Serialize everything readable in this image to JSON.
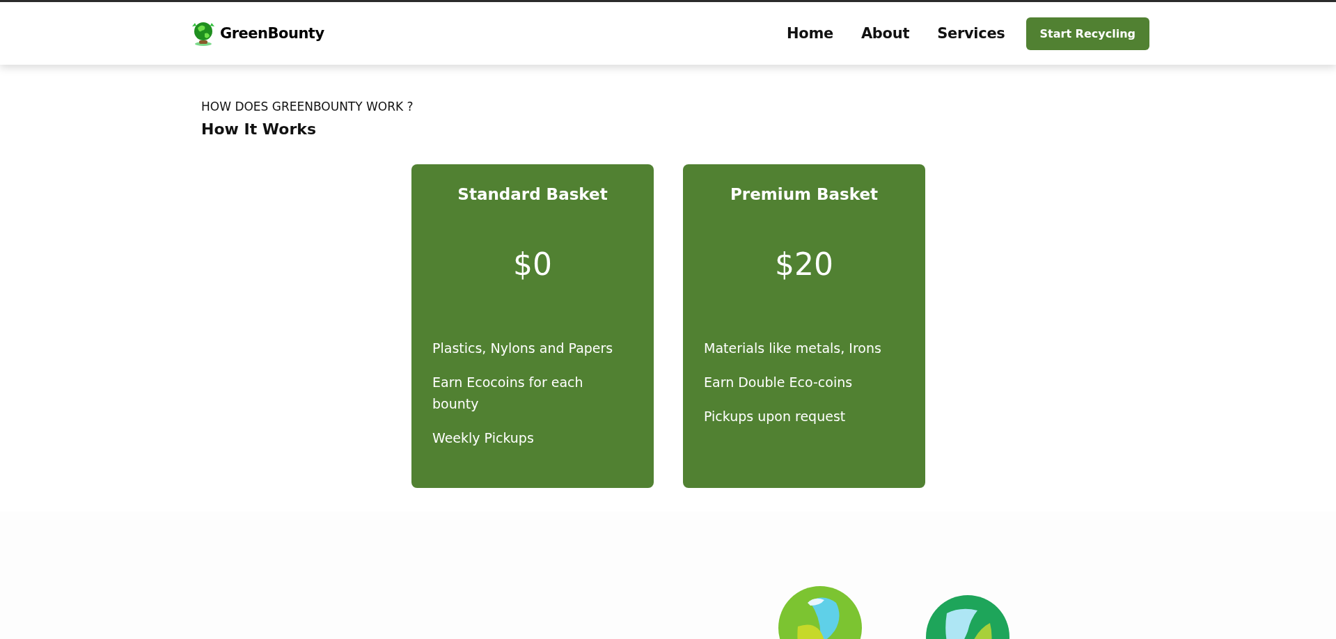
{
  "brand": {
    "name": "GreenBounty"
  },
  "nav": {
    "links": [
      {
        "label": "Home"
      },
      {
        "label": "About"
      },
      {
        "label": "Services"
      }
    ],
    "cta": "Start Recycling"
  },
  "section": {
    "eyebrow": "HOW DOES GREENBOUNTY WORK ?",
    "title": "How It Works"
  },
  "plans": [
    {
      "title": "Standard Basket",
      "price": "$0",
      "features": [
        "Plastics, Nylons and Papers",
        "Earn Ecocoins for each bounty",
        "Weekly Pickups"
      ]
    },
    {
      "title": "Premium Basket",
      "price": "$20",
      "features": [
        "Materials like metals, Irons",
        "Earn Double Eco-coins",
        "Pickups upon request"
      ]
    }
  ]
}
